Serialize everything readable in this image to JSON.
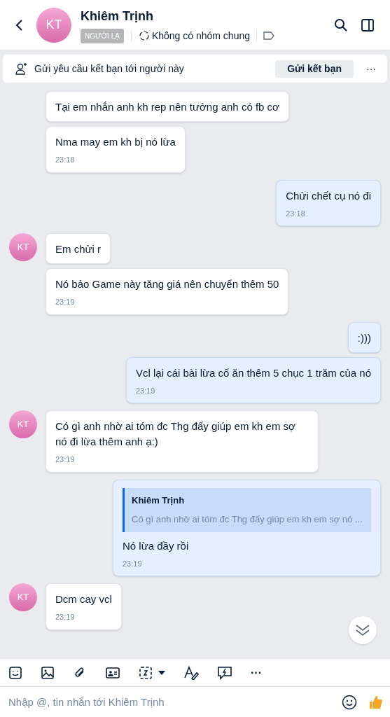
{
  "header": {
    "avatar_initials": "KT",
    "name": "Khiêm Trịnh",
    "badge": "NGƯỜI LẠ",
    "groups": "Không có nhóm chung"
  },
  "friend_bar": {
    "text": "Gửi yêu cầu kết bạn tới người này",
    "button": "Gửi kết bạn",
    "more": "···"
  },
  "messages": [
    {
      "kind": "incoming",
      "bubbles": [
        {
          "text": "Tại em nhắn anh kh rep nên tưởng anh có fb cơ"
        },
        {
          "text": "Nma may em kh bị nó lừa",
          "time": "23:18"
        }
      ]
    },
    {
      "kind": "outgoing",
      "bubbles": [
        {
          "text": "Chửi chết cụ nó đi",
          "time": "23:18"
        }
      ]
    },
    {
      "kind": "incoming",
      "avatar": "KT",
      "bubbles": [
        {
          "text": "Em chửi r"
        },
        {
          "text": "Nó bảo Game này tăng giá nên chuyển thêm 50",
          "time": "23:19"
        }
      ]
    },
    {
      "kind": "outgoing",
      "bubbles": [
        {
          "text": ":)))"
        },
        {
          "text": "Vcl lại cái bài lừa cố ăn thêm 5 chục 1 trăm của nó",
          "time": "23:19"
        }
      ]
    },
    {
      "kind": "incoming",
      "avatar": "KT",
      "bubbles": [
        {
          "text": "Có gì anh nhờ ai tóm đc Thg đấy giúp em kh em sợ nó đi lừa thêm anh ạ:)",
          "time": "23:19"
        }
      ]
    },
    {
      "kind": "outgoing",
      "bubbles": [
        {
          "quote": {
            "author": "Khiêm Trịnh",
            "text": "Có gì anh nhờ ai tóm đc Thg đấy giúp em kh em sợ nó ..."
          },
          "text": "Nó lừa đầy rồi",
          "time": "23:19"
        }
      ]
    },
    {
      "kind": "incoming",
      "avatar": "KT",
      "bubbles": [
        {
          "text": "Dcm cay vcl",
          "time": "23:19"
        }
      ]
    }
  ],
  "composer": {
    "placeholder": "Nhập @, tin nhắn tới Khiêm Trịnh",
    "more": "···"
  }
}
